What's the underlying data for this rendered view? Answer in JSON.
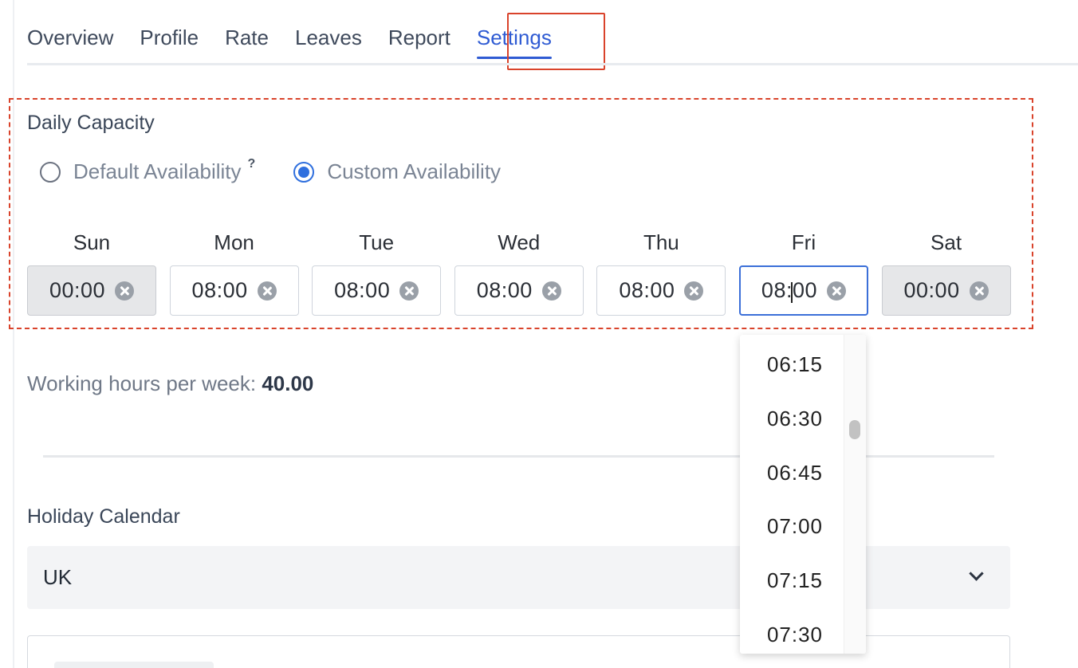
{
  "tabs": [
    {
      "label": "Overview"
    },
    {
      "label": "Profile"
    },
    {
      "label": "Rate"
    },
    {
      "label": "Leaves"
    },
    {
      "label": "Report"
    },
    {
      "label": "Settings",
      "active": true
    }
  ],
  "capacity": {
    "title": "Daily Capacity",
    "default_option": "Default Availability",
    "help_mark": "?",
    "custom_option": "Custom Availability",
    "selected": "custom",
    "days": [
      {
        "label": "Sun",
        "value": "00:00",
        "disabled": true
      },
      {
        "label": "Mon",
        "value": "08:00"
      },
      {
        "label": "Tue",
        "value": "08:00"
      },
      {
        "label": "Wed",
        "value": "08:00"
      },
      {
        "label": "Thu",
        "value": "08:00"
      },
      {
        "label": "Fri",
        "value": "08:00",
        "focused": true
      },
      {
        "label": "Sat",
        "value": "00:00",
        "disabled": true
      }
    ]
  },
  "hours": {
    "label": "Working hours per week:",
    "value": "40.00"
  },
  "holiday": {
    "title": "Holiday Calendar",
    "selected": "UK"
  },
  "dropdown": {
    "options": [
      "06:15",
      "06:30",
      "06:45",
      "07:00",
      "07:15",
      "07:30"
    ]
  },
  "colors": {
    "accent": "#2f5bd3",
    "highlight": "#d9432b",
    "radio": "#2f6fde"
  }
}
